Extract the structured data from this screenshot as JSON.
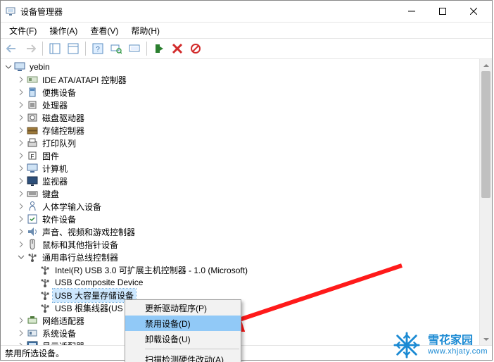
{
  "window": {
    "title": "设备管理器",
    "minimize_label": "Minimize",
    "maximize_label": "Maximize",
    "close_label": "Close"
  },
  "menu": {
    "file": "文件(F)",
    "action": "操作(A)",
    "view": "查看(V)",
    "help": "帮助(H)"
  },
  "tree": {
    "root": "yebin",
    "items": [
      {
        "label": "IDE ATA/ATAPI 控制器",
        "icon": "ide"
      },
      {
        "label": "便携设备",
        "icon": "portable"
      },
      {
        "label": "处理器",
        "icon": "cpu"
      },
      {
        "label": "磁盘驱动器",
        "icon": "disk"
      },
      {
        "label": "存储控制器",
        "icon": "storage"
      },
      {
        "label": "打印队列",
        "icon": "printer"
      },
      {
        "label": "固件",
        "icon": "firmware"
      },
      {
        "label": "计算机",
        "icon": "computer"
      },
      {
        "label": "监视器",
        "icon": "monitor"
      },
      {
        "label": "键盘",
        "icon": "keyboard"
      },
      {
        "label": "人体学输入设备",
        "icon": "hid"
      },
      {
        "label": "软件设备",
        "icon": "software"
      },
      {
        "label": "声音、视频和游戏控制器",
        "icon": "sound"
      },
      {
        "label": "鼠标和其他指针设备",
        "icon": "mouse"
      },
      {
        "label": "通用串行总线控制器",
        "icon": "usb",
        "expanded": true
      }
    ],
    "usb_children": [
      {
        "label": "Intel(R) USB 3.0 可扩展主机控制器 - 1.0 (Microsoft)",
        "icon": "usbctrl"
      },
      {
        "label": "USB Composite Device",
        "icon": "usbctrl"
      },
      {
        "label": "USB 大容量存储设备",
        "icon": "usbctrl",
        "selected": true
      },
      {
        "label": "USB 根集线器(US",
        "icon": "usbctrl"
      }
    ],
    "after_usb": [
      {
        "label": "网络适配器",
        "icon": "network"
      },
      {
        "label": "系统设备",
        "icon": "system"
      },
      {
        "label": "显示适配器",
        "icon": "display"
      }
    ]
  },
  "context_menu": {
    "update_driver": "更新驱动程序(P)",
    "disable_device": "禁用设备(D)",
    "uninstall": "卸载设备(U)",
    "scan_hw": "扫描检测硬件改动(A)"
  },
  "status": "禁用所选设备。",
  "watermark": {
    "brand": "雪花家园",
    "url": "www.xhjaty.com"
  }
}
